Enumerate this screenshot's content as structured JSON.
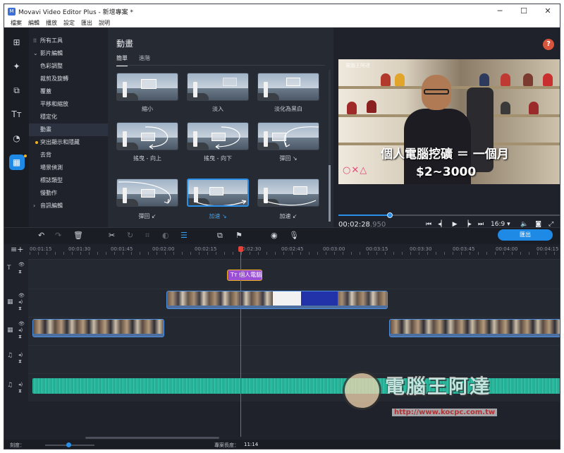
{
  "window": {
    "title": "Movavi Video Editor Plus - 新增專案 *",
    "app_icon": "movavi-icon",
    "controls": [
      "─",
      "☐",
      "✕"
    ]
  },
  "menu": [
    "檔案",
    "編輯",
    "播放",
    "設定",
    "匯出",
    "說明"
  ],
  "tools_tree": {
    "all_tools": "所有工具",
    "video_editing": "影片編輯",
    "items": [
      "色彩調整",
      "裁剪及旋轉",
      "覆蓋",
      "平移和縮放",
      "穩定化",
      "動畫",
      "突出顯示和隱藏",
      "去背",
      "場景偵測",
      "標誌類型",
      "慢動作"
    ],
    "audio_editing": "音訊編輯",
    "selected": "動畫"
  },
  "panel": {
    "title": "動畫",
    "tabs": [
      "簡單",
      "進階"
    ],
    "active_tab": "簡單",
    "animations": [
      "縮小",
      "淡入",
      "淡化為黑白",
      "搖曳 - 向上",
      "搖曳 - 向下",
      "彈回 ↘",
      "彈回 ↙",
      "加速 ↘",
      "加速 ↙"
    ],
    "selected": "加速 ↘"
  },
  "preview": {
    "help_label": "?",
    "caption_line1": "個人電腦挖礦 ＝ 一個月",
    "caption_line2": "$2~3000",
    "ps_symbols": "○✕△",
    "watermark_small": "電腦王阿達",
    "timecode_main": "00:02:28",
    "timecode_frac": ".950",
    "ratio": "16:9 ▾",
    "progress_fraction": 0.23
  },
  "timeline": {
    "export_label": "匯出",
    "ruler_labels": [
      "00:01:15",
      "00:01:30",
      "00:01:45",
      "00:02:00",
      "00:02:15",
      "00:02:30",
      "00:02:45",
      "00:03:00",
      "00:03:15",
      "00:03:30",
      "00:03:45",
      "00:04:00",
      "00:04:15"
    ],
    "title_clip_text": "個人電腦",
    "title_icon": "Tт"
  },
  "watermark": {
    "text": "電腦王阿達",
    "url": "http://www.kocpc.com.tw"
  },
  "status": {
    "scale_label": "刻度：",
    "length_label": "專案長度：",
    "length_value": "11:14"
  }
}
